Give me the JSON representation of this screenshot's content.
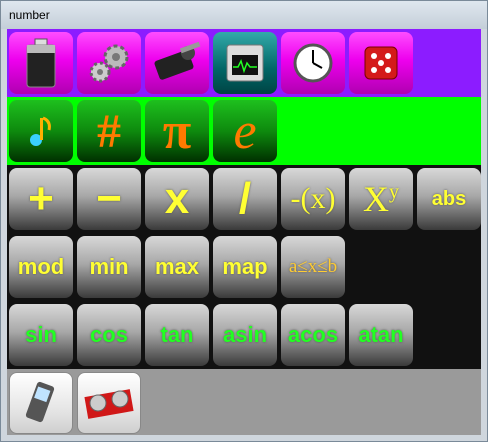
{
  "window": {
    "title": "number"
  },
  "row1": {
    "icons": [
      "battery-icon",
      "gears-icon",
      "servo-motor-icon",
      "system-monitor-icon",
      "clock-icon",
      "dice-icon"
    ]
  },
  "row2": {
    "items": [
      {
        "icon": "music-note-icon",
        "label": ""
      },
      {
        "icon": "hash-icon",
        "label": "#"
      },
      {
        "icon": "pi-icon",
        "label": "π"
      },
      {
        "icon": "euler-e-icon",
        "label": "e"
      }
    ]
  },
  "row3": {
    "plus": "+",
    "minus": "−",
    "multiply": "x",
    "divide": "/",
    "negate": "-(x)",
    "power_base": "X",
    "power_exp": "y",
    "abs": "abs"
  },
  "row4": {
    "mod": "mod",
    "min": "min",
    "max": "max",
    "map": "map",
    "range": "a≤x≤b"
  },
  "row5": {
    "sin": "sin",
    "cos": "cos",
    "tan": "tan",
    "asin": "asin",
    "acos": "acos",
    "atan": "atan"
  },
  "row6": {
    "icons": [
      "mobile-phone-icon",
      "ultrasonic-sensor-icon"
    ]
  },
  "colors": {
    "row1_bg": "#8c1cff",
    "row2_bg": "#00ff00",
    "label_yellow": "#ffff33",
    "label_green": "#22ff22",
    "accent_orange": "#ff7a00"
  }
}
